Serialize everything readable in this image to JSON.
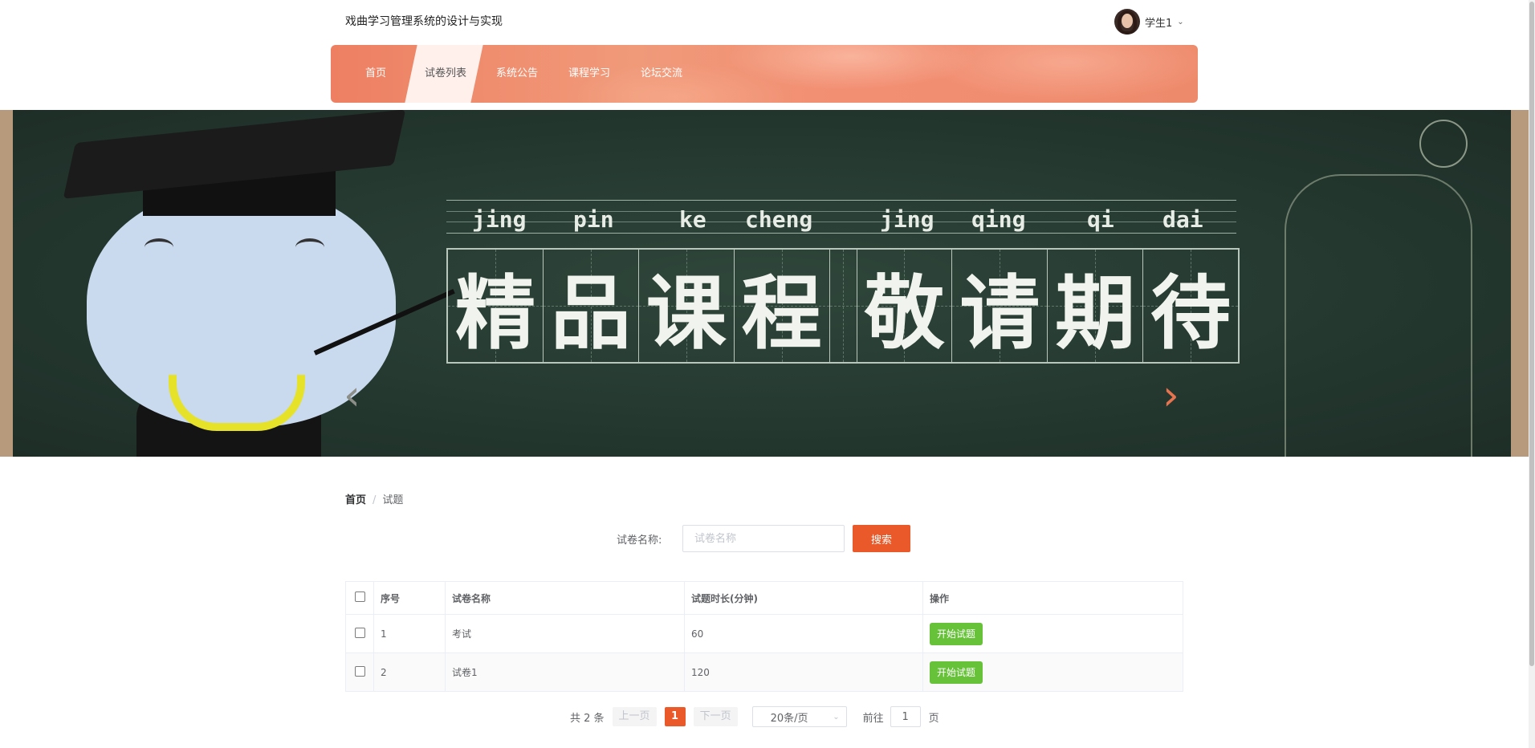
{
  "header": {
    "site_title": "戏曲学习管理系统的设计与实现",
    "user_name": "学生1",
    "user_dropdown_icon": "chevron-down-icon"
  },
  "nav": {
    "items": [
      {
        "label": "首页"
      },
      {
        "label": "试卷列表",
        "active": true
      },
      {
        "label": "系统公告"
      },
      {
        "label": "课程学习"
      },
      {
        "label": "论坛交流"
      }
    ]
  },
  "banner": {
    "pinyin": [
      "jing",
      "pin",
      "ke",
      "cheng",
      "jing",
      "qing",
      "qi",
      "dai"
    ],
    "chars": [
      "精",
      "品",
      "课",
      "程",
      "敬",
      "请",
      "期",
      "待"
    ],
    "prev_icon": "chevron-left-icon",
    "next_icon": "chevron-right-icon",
    "accent_color": "#e8734f"
  },
  "breadcrumb": {
    "home": "首页",
    "separator": "/",
    "current": "试题"
  },
  "search": {
    "label": "试卷名称:",
    "placeholder": "试卷名称",
    "value": "",
    "button_label": "搜索",
    "button_color": "#e9592a"
  },
  "table": {
    "columns": [
      "序号",
      "试卷名称",
      "试题时长(分钟)",
      "操作"
    ],
    "rows": [
      {
        "index": "1",
        "name": "考试",
        "duration": "60",
        "action": "开始试题"
      },
      {
        "index": "2",
        "name": "试卷1",
        "duration": "120",
        "action": "开始试题"
      }
    ],
    "action_color": "#67c23a"
  },
  "pagination": {
    "total": "共 2 条",
    "prev": "上一页",
    "current_page": "1",
    "next": "下一页",
    "page_size": "20条/页",
    "goto_label": "前往",
    "goto_value": "1",
    "goto_unit": "页"
  }
}
